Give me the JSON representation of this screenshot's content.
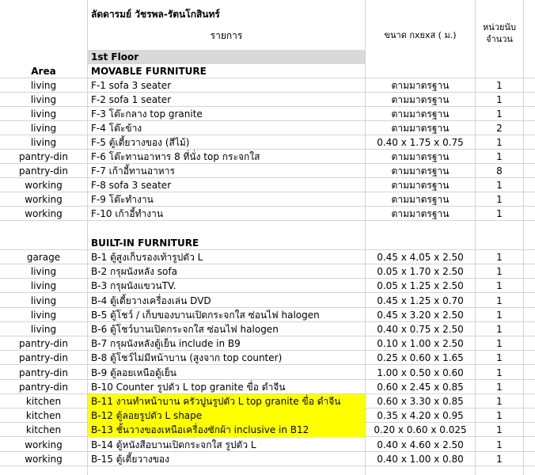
{
  "title": "ลัดดารมย์ วัชรพล-รัตนโกสินทร์",
  "header": {
    "item_col": "รายการ",
    "size_col": "ขนาด      กxยxส  ( ม.)",
    "unit_line1": "หน่วยนับ",
    "unit_line2": "จำนวน"
  },
  "floor": "1st Floor",
  "area_label": "Area",
  "movable_heading": "MOVABLE FURNITURE",
  "movable": [
    {
      "area": "living",
      "item": "F-1  sofa 3 seater",
      "size": "ตามมาตรฐาน",
      "qty": "1"
    },
    {
      "area": "living",
      "item": "F-2  sofa 1 seater",
      "size": "ตามมาตรฐาน",
      "qty": "1"
    },
    {
      "area": "living",
      "item": "F-3  โต๊ะกลาง top granite",
      "size": "ตามมาตรฐาน",
      "qty": "1"
    },
    {
      "area": "living",
      "item": "F-4  โต๊ะข้าง",
      "size": "ตามมาตรฐาน",
      "qty": "2"
    },
    {
      "area": "living",
      "item": "F-5  ตู้เตี้ยวางของ (สีไม้)",
      "size": "0.40 x 1.75 x 0.75",
      "qty": "1"
    },
    {
      "area": "pantry-din",
      "item": "F-6   โต๊ะทานอาหาร 8 ที่นั่ง top กระจกใส",
      "size": "ตามมาตรฐาน",
      "qty": "1"
    },
    {
      "area": "pantry-din",
      "item": "F-7    เก้าอี้ทานอาหาร",
      "size": "ตามมาตรฐาน",
      "qty": "8"
    },
    {
      "area": "working",
      "item": "F-8   sofa 3 seater",
      "size": "ตามมาตรฐาน",
      "qty": "1"
    },
    {
      "area": "working",
      "item": "F-9   โต๊ะทำงาน",
      "size": "ตามมาตรฐาน",
      "qty": "1"
    },
    {
      "area": "working",
      "item": "F-10  เก้าอี้ทำงาน",
      "size": "ตามมาตรฐาน",
      "qty": "1"
    }
  ],
  "builtin_heading": "BUILT-IN  FURNITURE",
  "builtin": [
    {
      "area": "garage",
      "item": "B-1  ตู้สูงเก็บรองเท้ารูปตัว L",
      "size": "0.45 x 4.05 x 2.50",
      "qty": "1",
      "hl": false
    },
    {
      "area": "living",
      "item": "B-2  กรุผนังหลัง sofa",
      "size": "0.05 x 1.70 x 2.50",
      "qty": "1",
      "hl": false
    },
    {
      "area": "living",
      "item": "B-3  กรุผนังแขวนTV.",
      "size": "0.05 x 1.25 x 2.50",
      "qty": "1",
      "hl": false
    },
    {
      "area": "living",
      "item": "B-4  ตู้เตี้ยวางเครื่องเล่น DVD",
      "size": "0.45 x 1.25 x 0.70",
      "qty": "1",
      "hl": false
    },
    {
      "area": "living",
      "item": "B-5  ตู้โชว์ / เก็บของบานเปิดกระจกใส ซ่อนไฟ halogen",
      "size": "0.45 x 3.20 x 2.50",
      "qty": "1",
      "hl": false
    },
    {
      "area": "living",
      "item": "B-6  ตู้โชว์บานเปิดกระจกใส ซ่อนไฟ halogen",
      "size": "0.40 x 0.75 x 2.50",
      "qty": "1",
      "hl": false
    },
    {
      "area": "pantry-din",
      "item": "B-7  กรุผนังหลังตู้เย็น include in B9",
      "size": "0.10 x 1.00 x 2.50",
      "qty": "1",
      "hl": false
    },
    {
      "area": "pantry-din",
      "item": "B-8  ตู้โชว์ไม่มีหน้าบาน (สูงจาก top counter)",
      "size": "0.25 x 0.60 x 1.65",
      "qty": "1",
      "hl": false
    },
    {
      "area": "pantry-din",
      "item": "B-9  ตู้ลอยเหนือตู้เย็น",
      "size": "1.00 x 0.50 x 0.60",
      "qty": "1",
      "hl": false
    },
    {
      "area": "pantry-din",
      "item": "B-10  Counter รูปตัว L top granite ขื่อ ดำจีน",
      "size": "0.60 x 2.45 x 0.85",
      "qty": "1",
      "hl": false
    },
    {
      "area": "kitchen",
      "item": "B-11  งานทำหน้าบาน ครัวปูนรูปตัว L top granite ขื่อ ดำจีน",
      "size": "0.60 x 3.30 x 0.85",
      "qty": "1",
      "hl": true
    },
    {
      "area": "kitchen",
      "item": "B-12  ตู้ลอยรูปตัว L shape",
      "size": "0.35 x 4.20 x 0.95",
      "qty": "1",
      "hl": true
    },
    {
      "area": "kitchen",
      "item": "B-13  ชั้นวางของเหนือเครื่องซักผ้า inclusive in B12",
      "size": "0.20 x 0.60 x 0.025",
      "qty": "1",
      "hl": true
    },
    {
      "area": "working",
      "item": "B-14  ตู้หนังสือบานเปิดกระจกใส รูปตัว L",
      "size": "0.40 x 4.60 x 2.50",
      "qty": "1",
      "hl": false
    },
    {
      "area": "working",
      "item": "B-15  ตู้เตี้ยวางของ",
      "size": "0.40 x 1.00 x 0.80",
      "qty": "1",
      "hl": false
    }
  ]
}
